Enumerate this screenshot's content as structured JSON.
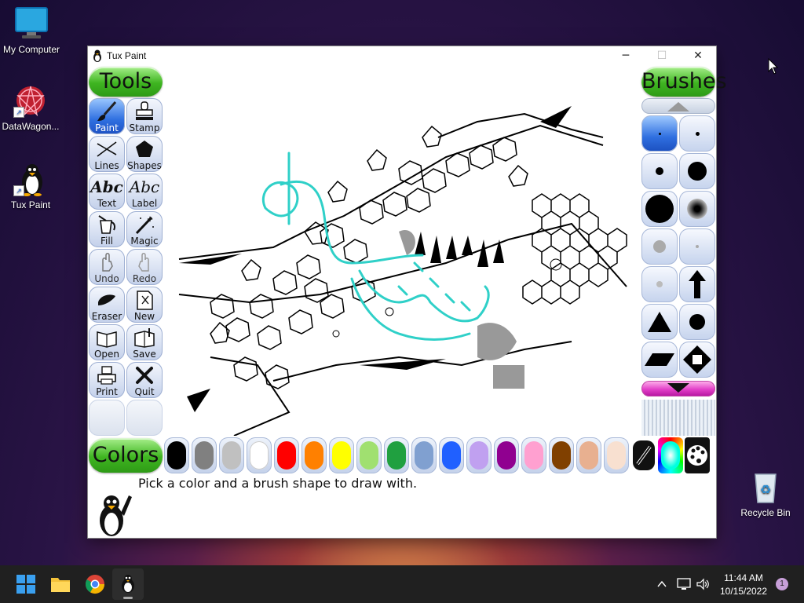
{
  "desktop": {
    "icons": [
      {
        "label": "My Computer",
        "icon": "monitor-icon"
      },
      {
        "label": "DataWagon...",
        "icon": "datawagon-icon"
      },
      {
        "label": "Tux Paint",
        "icon": "tux-penguin-icon"
      },
      {
        "label": "Recycle Bin",
        "icon": "recycle-bin-icon"
      }
    ]
  },
  "window": {
    "title": "Tux Paint",
    "controls": {
      "minimize": "─",
      "maximize": "☐",
      "close": "✕"
    }
  },
  "tools": {
    "header": "Tools",
    "items": [
      {
        "label": "Paint",
        "icon": "paintbrush-icon",
        "selected": true
      },
      {
        "label": "Stamp",
        "icon": "stamp-icon"
      },
      {
        "label": "Lines",
        "icon": "lines-icon"
      },
      {
        "label": "Shapes",
        "icon": "pentagon-icon"
      },
      {
        "label": "Text",
        "icon": "text-abc-icon",
        "glyph": "Abc"
      },
      {
        "label": "Label",
        "icon": "label-abc-icon",
        "glyph": "Abc"
      },
      {
        "label": "Fill",
        "icon": "paint-bucket-icon"
      },
      {
        "label": "Magic",
        "icon": "magic-wand-icon"
      },
      {
        "label": "Undo",
        "icon": "undo-hand-icon"
      },
      {
        "label": "Redo",
        "icon": "redo-hand-icon"
      },
      {
        "label": "Eraser",
        "icon": "eraser-icon"
      },
      {
        "label": "New",
        "icon": "new-page-icon"
      },
      {
        "label": "Open",
        "icon": "open-book-icon"
      },
      {
        "label": "Save",
        "icon": "save-book-icon"
      },
      {
        "label": "Print",
        "icon": "printer-icon"
      },
      {
        "label": "Quit",
        "icon": "quit-x-icon"
      }
    ]
  },
  "brushes": {
    "header": "Brushes",
    "items": [
      {
        "icon": "brush-tiny-dot-icon",
        "selected": true
      },
      {
        "icon": "brush-small-dot-icon"
      },
      {
        "icon": "brush-medium-dot-icon"
      },
      {
        "icon": "brush-large-dot-icon"
      },
      {
        "icon": "brush-xlarge-dot-icon"
      },
      {
        "icon": "brush-fuzzy-dot-icon"
      },
      {
        "icon": "brush-gray-dot-icon"
      },
      {
        "icon": "brush-faint-dot-icon"
      },
      {
        "icon": "brush-faint-gray-dot-icon"
      },
      {
        "icon": "brush-arrow-icon"
      },
      {
        "icon": "brush-triangle-icon"
      },
      {
        "icon": "brush-round-icon"
      },
      {
        "icon": "brush-rhombus-icon"
      },
      {
        "icon": "brush-diamond-icon"
      }
    ]
  },
  "colors": {
    "header": "Colors",
    "swatches": [
      "#000000",
      "#808080",
      "#c0c0c0",
      "#ffffff",
      "#ff0000",
      "#ff8000",
      "#ffff00",
      "#a0e070",
      "#20a040",
      "#80a0d0",
      "#2060ff",
      "#c0a0f0",
      "#900090",
      "#ff a0d0",
      "#804000",
      "#e8b090",
      "#f8e0d0"
    ],
    "extras": [
      {
        "icon": "color-picker-icon"
      },
      {
        "icon": "rainbow-icon"
      },
      {
        "icon": "color-palette-icon"
      }
    ]
  },
  "status": {
    "message": "Pick a color and a brush shape to draw with."
  },
  "taskbar": {
    "apps": [
      {
        "icon": "windows-start-icon"
      },
      {
        "icon": "file-explorer-icon"
      },
      {
        "icon": "chrome-icon"
      },
      {
        "icon": "tux-paint-taskbar-icon"
      }
    ],
    "time": "11:44 AM",
    "date": "10/15/2022",
    "notification_count": "1"
  },
  "accent": "#2f6fe0",
  "pill_green": "#3fb521"
}
